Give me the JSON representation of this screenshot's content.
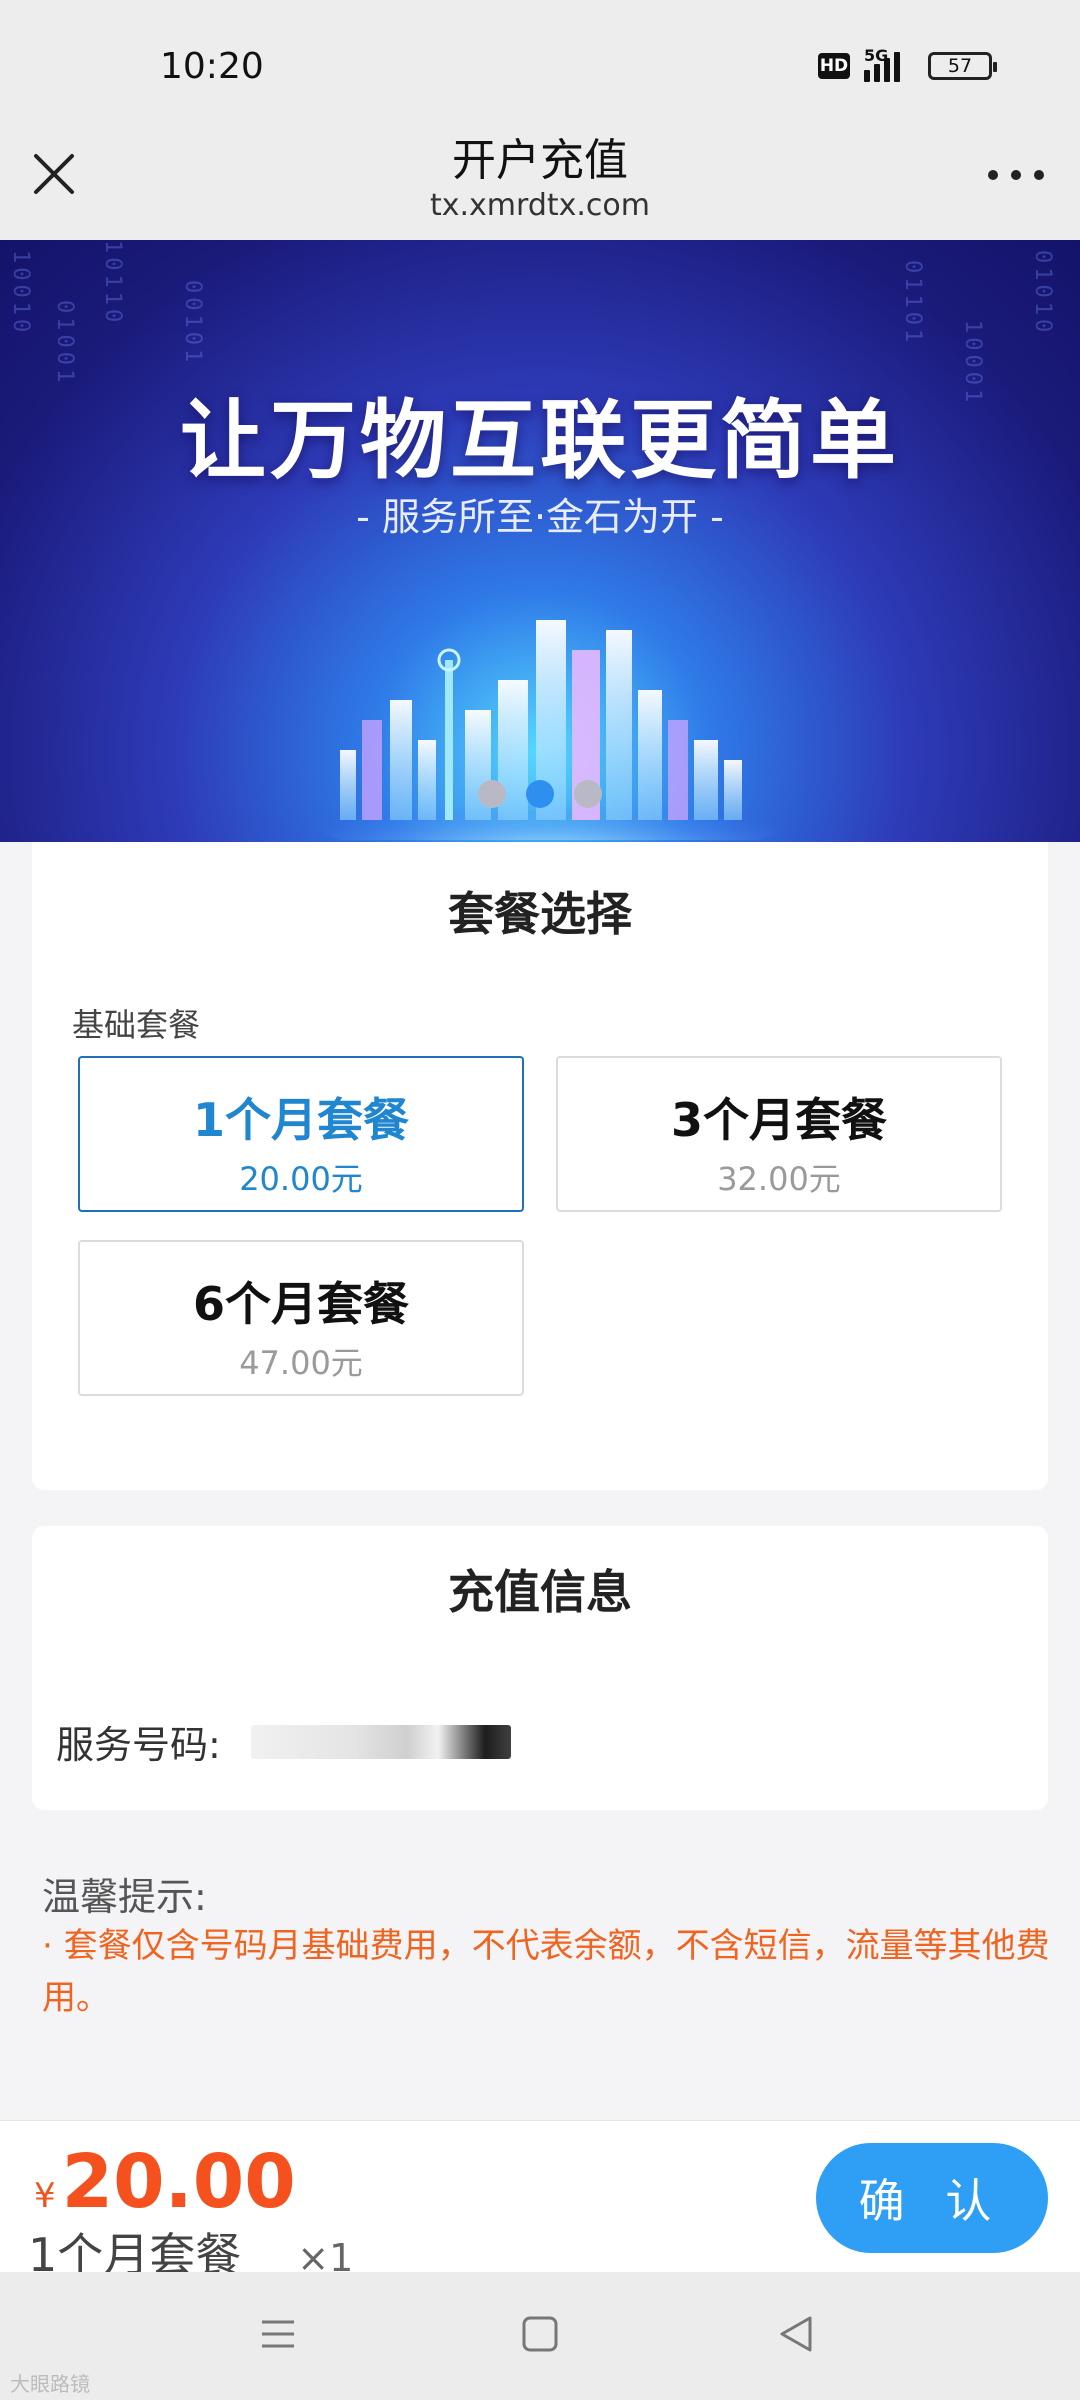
{
  "status_bar": {
    "time": "10:20",
    "hd": "HD",
    "network": "5G",
    "battery": "57"
  },
  "nav": {
    "title": "开户充值",
    "url": "tx.xmrdtx.com"
  },
  "banner": {
    "title": "让万物互联更简单",
    "subtitle": "- 服务所至·金石为开 -",
    "binary": [
      "10010",
      "01001",
      "10110",
      "00101",
      "01101",
      "10001",
      "01010"
    ],
    "slide_count": 3,
    "active_slide": 1
  },
  "package_section": {
    "title": "套餐选择",
    "group_label": "基础套餐",
    "options": [
      {
        "name": "1个月套餐",
        "price": "20.00元",
        "selected": true
      },
      {
        "name": "3个月套餐",
        "price": "32.00元",
        "selected": false
      },
      {
        "name": "6个月套餐",
        "price": "47.00元",
        "selected": false
      }
    ]
  },
  "recharge_section": {
    "title": "充值信息",
    "service_label": "服务号码:"
  },
  "tips": {
    "title": "温馨提示:",
    "text": "· 套餐仅含号码月基础费用，不代表余额，不含短信，流量等其他费用。"
  },
  "bottom_bar": {
    "currency": "¥",
    "amount": "20.00",
    "summary": "1个月套餐",
    "quantity": "×1",
    "confirm": "确 认"
  },
  "watermark": "大眼路镜",
  "colors": {
    "accent_blue": "#2e9ff5",
    "selected_blue": "#2186d0",
    "price_orange": "#f4511e",
    "tip_orange": "#f06420"
  }
}
